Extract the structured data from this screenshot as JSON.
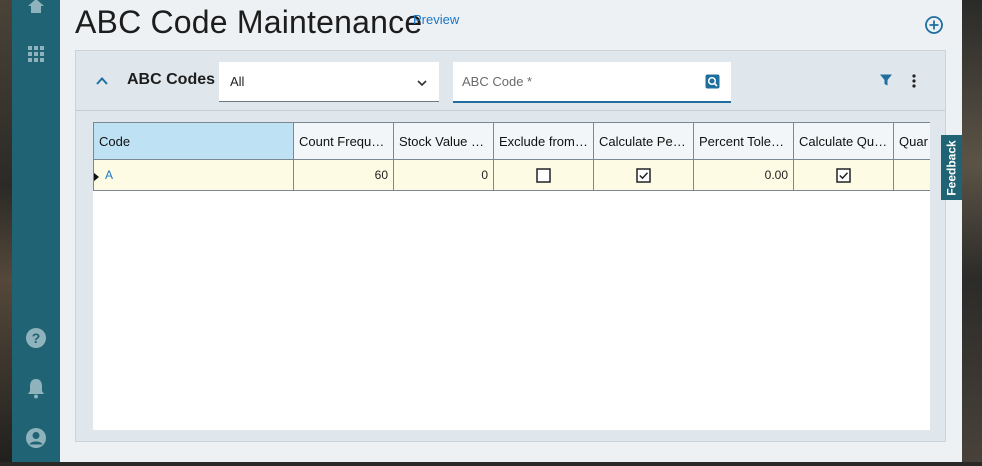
{
  "page": {
    "title": "ABC Code Maintenance",
    "preview_label": "Preview"
  },
  "rail": {
    "icons": [
      "home-icon",
      "apps-grid-icon",
      "help-icon",
      "bell-icon",
      "user-icon"
    ]
  },
  "panel": {
    "title": "ABC Codes",
    "filter_select": {
      "value": "All"
    },
    "search": {
      "placeholder": "ABC Code *"
    }
  },
  "grid": {
    "columns": [
      "Code",
      "Count Frequ…",
      "Stock Value P…",
      "Exclude from…",
      "Calculate Per…",
      "Percent Toler…",
      "Calculate Qu…",
      "Quar"
    ],
    "rows": [
      {
        "code": "A",
        "count_frequency": "60",
        "stock_value": "0",
        "exclude": false,
        "calculate_percent": true,
        "percent_tolerance": "0.00",
        "calculate_quantity": true,
        "quantity": ""
      }
    ]
  },
  "feedback": {
    "label": "Feedback"
  },
  "colors": {
    "rail": "#1f6374",
    "accent": "#1a76c6",
    "row_highlight": "#fdfbe3",
    "header_selected": "#bfe1f4"
  }
}
